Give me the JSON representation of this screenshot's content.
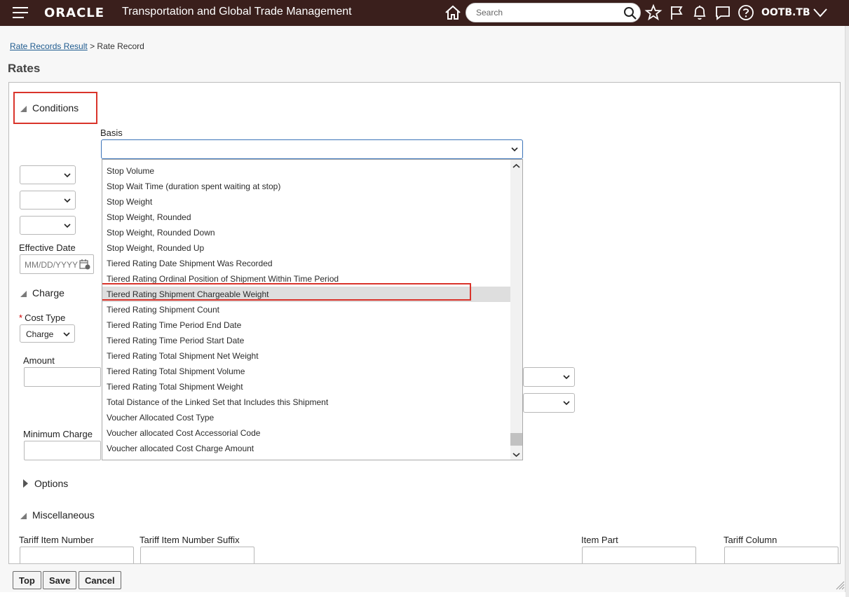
{
  "header": {
    "brand": "ORACLE",
    "app_title": "Transportation and Global Trade Management",
    "search_placeholder": "Search",
    "user": "OOTB.TB"
  },
  "breadcrumb": {
    "link": "Rate Records Result",
    "separator": ">",
    "current": "Rate Record"
  },
  "page_title": "Rates",
  "conditions": {
    "heading": "Conditions",
    "basis_label": "Basis",
    "basis_value": "",
    "effective_date_label": "Effective Date",
    "effective_date_placeholder": "MM/DD/YYYY"
  },
  "basis_options": [
    "Stop Volume",
    "Stop Wait Time (duration spent waiting at stop)",
    "Stop Weight",
    "Stop Weight, Rounded",
    "Stop Weight, Rounded Down",
    "Stop Weight, Rounded Up",
    "Tiered Rating Date Shipment Was Recorded",
    "Tiered Rating Ordinal Position of Shipment Within Time Period",
    "Tiered Rating Shipment Chargeable Weight",
    "Tiered Rating Shipment Count",
    "Tiered Rating Time Period End Date",
    "Tiered Rating Time Period Start Date",
    "Tiered Rating Total Shipment Net Weight",
    "Tiered Rating Total Shipment Volume",
    "Tiered Rating Total Shipment Weight",
    "Total Distance of the Linked Set that Includes this Shipment",
    "Voucher Allocated Cost Type",
    "Voucher allocated Cost Accessorial Code",
    "Voucher allocated Cost Charge Amount"
  ],
  "basis_highlighted": "Tiered Rating Shipment Chargeable Weight",
  "charge": {
    "heading": "Charge",
    "cost_type_label": "Cost Type",
    "cost_type_required": "*",
    "cost_type_value": "Charge",
    "amount_label": "Amount",
    "minimum_charge_label": "Minimum Charge"
  },
  "options": {
    "heading": "Options"
  },
  "miscellaneous": {
    "heading": "Miscellaneous",
    "tariff_item_number_label": "Tariff Item Number",
    "tariff_item_number_suffix_label": "Tariff Item Number Suffix",
    "item_part_label": "Item Part",
    "tariff_column_label": "Tariff Column"
  },
  "buttons": {
    "top": "Top",
    "save": "Save",
    "cancel": "Cancel"
  },
  "colors": {
    "header_bg": "#3a1f1c",
    "highlight_red": "#d9342b",
    "focus_blue": "#3b73b9"
  }
}
